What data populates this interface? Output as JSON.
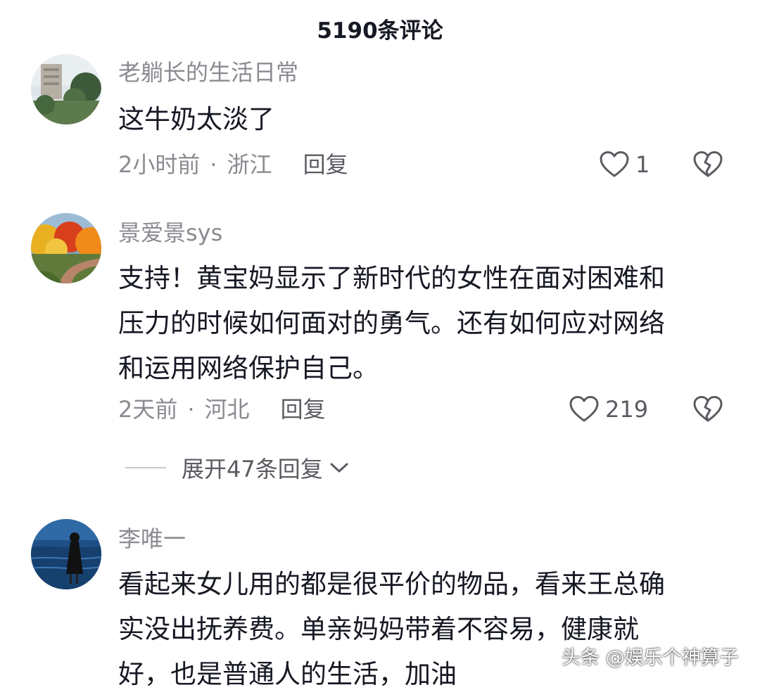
{
  "header": {
    "title": "5190条评论"
  },
  "comments": [
    {
      "username": "老躺长的生活日常",
      "content_lines": [
        "这牛奶太淡了"
      ],
      "time": "2小时前",
      "separator": "·",
      "location": "浙江",
      "reply_label": "回复",
      "like_count": "1"
    },
    {
      "username": "景爱景sys",
      "content_lines": [
        "支持！黄宝妈显示了新时代的女性在面对困难和",
        "压力的时候如何面对的勇气。还有如何应对网络",
        "和运用网络保护自己。"
      ],
      "time": "2天前",
      "separator": "·",
      "location": "河北",
      "reply_label": "回复",
      "like_count": "219",
      "expand_label": "展开47条回复"
    },
    {
      "username": "李唯一",
      "content_lines": [
        "看起来女儿用的都是很平价的物品，看来王总确",
        "实没出抚养费。单亲妈妈带着不容易，健康就",
        "好，也是普通人的生活，加油"
      ]
    }
  ],
  "icons": {
    "like": "heart-outline-icon",
    "dislike": "broken-heart-icon",
    "expand": "chevron-down-icon"
  },
  "watermark": "头条 @娱乐个神算子",
  "colors": {
    "text_primary": "#161823",
    "text_secondary": "#8a8b91",
    "text_action": "#5a5b61",
    "background": "#ffffff"
  }
}
